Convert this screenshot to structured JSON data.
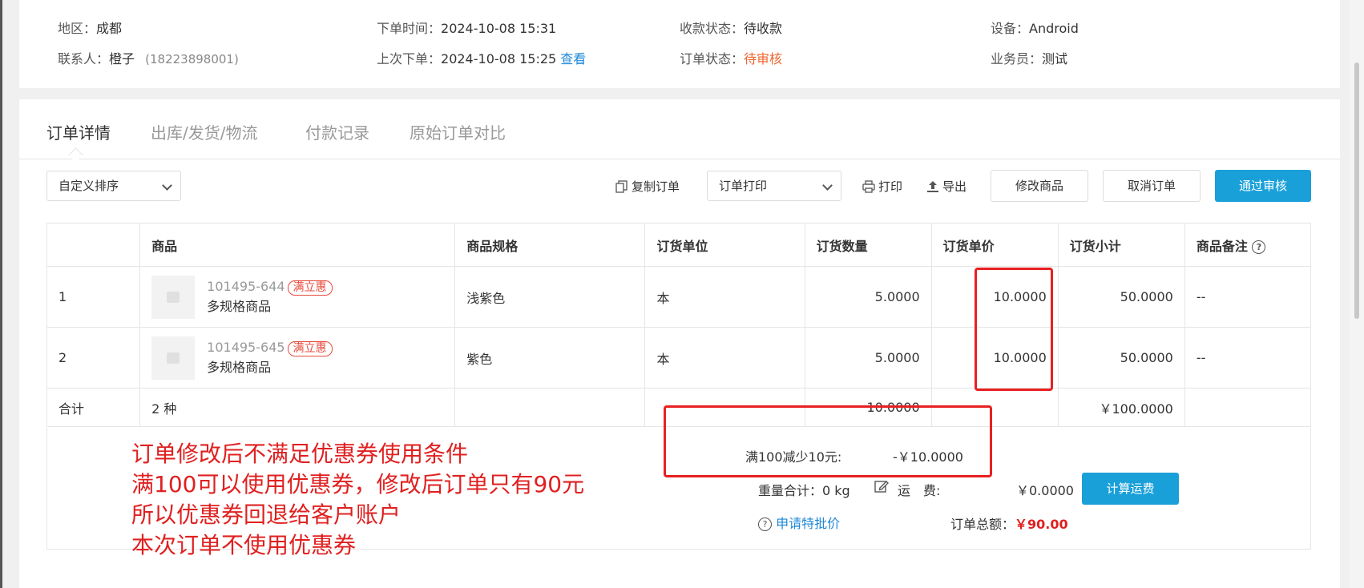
{
  "info": {
    "region_label": "地区：",
    "region": "成都",
    "contact_label": "联系人：",
    "contact": "橙子",
    "contact_phone": "(18223898001)",
    "order_time_label": "下单时间：",
    "order_time": "2024-10-08 15:31",
    "last_order_label": "上次下单：",
    "last_order": "2024-10-08 15:25",
    "view_link": "查看",
    "payment_status_label": "收款状态：",
    "payment_status": "待收款",
    "order_status_label": "订单状态：",
    "order_status": "待审核",
    "device_label": "设备：",
    "device": "Android",
    "sales_label": "业务员：",
    "sales": "测试"
  },
  "tabs": [
    "订单详情",
    "出库/发货/物流",
    "付款记录",
    "原始订单对比"
  ],
  "toolbar": {
    "sort_select": "自定义排序",
    "copy_order": "复制订单",
    "print_select": "订单打印",
    "print": "打印",
    "export": "导出",
    "modify_goods": "修改商品",
    "cancel_order": "取消订单",
    "approve": "通过审核"
  },
  "table": {
    "headers": [
      "",
      "商品",
      "商品规格",
      "订货单位",
      "订货数量",
      "订货单价",
      "订货小计",
      "商品备注"
    ],
    "rows": [
      {
        "index": "1",
        "code": "101495-644",
        "tag": "满立惠",
        "name": "多规格商品",
        "spec": "浅紫色",
        "unit": "本",
        "qty": "5.0000",
        "price": "10.0000",
        "subtotal": "50.0000",
        "remark": "--"
      },
      {
        "index": "2",
        "code": "101495-645",
        "tag": "满立惠",
        "name": "多规格商品",
        "spec": "紫色",
        "unit": "本",
        "qty": "5.0000",
        "price": "10.0000",
        "subtotal": "50.0000",
        "remark": "--"
      }
    ],
    "summary": {
      "label": "合计",
      "kinds": "2 种",
      "qty": "10.0000",
      "subtotal": "￥100.0000"
    }
  },
  "footer": {
    "discount_label": "满100减少10元:",
    "discount_value": "-￥10.0000",
    "weight": "重量合计：0 kg",
    "freight_label": "运　费:",
    "freight_value": "￥0.0000",
    "calc_freight": "计算运费",
    "special_price": "申请特批价",
    "total_label": "订单总额：",
    "total_value": "￥90.00"
  },
  "annotation": [
    "订单修改后不满足优惠券使用条件",
    "满100可以使用优惠券，修改后订单只有90元",
    "所以优惠券回退给客户账户",
    "本次订单不使用优惠券"
  ],
  "colors": {
    "accent": "#1aa0d9",
    "link": "#1e88d6",
    "warning": "#f0642d",
    "annotation": "#e02020",
    "total": "#e02020"
  }
}
